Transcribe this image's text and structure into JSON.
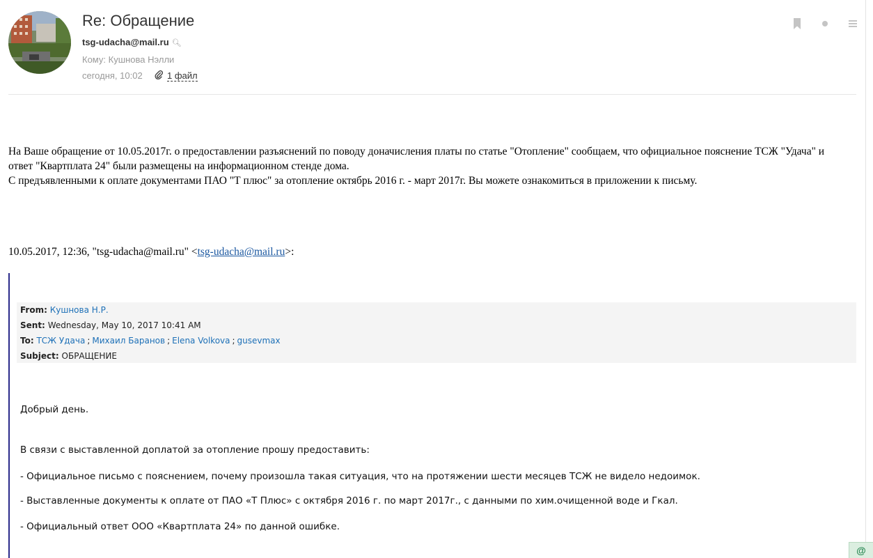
{
  "message": {
    "subject": "Re: Обращение",
    "from": "tsg-udacha@mail.ru",
    "to_label": "Кому:",
    "to": "Кушнова Нэлли",
    "date": "сегодня, 10:02",
    "attachments_label": "1 файл"
  },
  "toolbar": {
    "flag_icon": "bookmark-icon",
    "unread_icon": "dot-icon",
    "more_icon": "menu-icon"
  },
  "body": {
    "line1": "На Ваше обращение от 10.05.2017г. о предоставлении разъяснений по поводу доначисления платы по статье \"Отопление\" сообщаем, что официальное пояснение ТСЖ \"Удача\" и",
    "line2": "ответ \"Квартплата 24\" были размещены на информационном стенде дома.",
    "line3": "С предъявленными к оплате документами ПАО \"Т плюс\" за отопление октябрь 2016 г. - март 2017г. Вы можете ознакомиться в приложении к письму."
  },
  "quote_header": {
    "prefix": "10.05.2017, 12:36, \"tsg-udacha@mail.ru\" <",
    "link": "tsg-udacha@mail.ru",
    "suffix": ">:"
  },
  "original": {
    "from_label": "From:",
    "from": "Кушнова Н.Р.",
    "sent_label": "Sent:",
    "sent": "Wednesday, May 10, 2017 10:41 AM",
    "to_label": "To:",
    "recipients": [
      "ТСЖ Удача",
      "Михаил Баранов",
      "Elena Volkova",
      "gusevmax"
    ],
    "separator": ";",
    "subject_label": "Subject:",
    "subject": "ОБРАЩЕНИЕ",
    "greeting": "Добрый день.",
    "intro": "В связи с выставленной доплатой за отопление прошу предоставить:",
    "items": [
      "- Официальное письмо с пояснением, почему произошла такая ситуация, что на протяжении  шести месяцев ТСЖ не видело недоимок.",
      "- Выставленные документы к оплате от ПАО «Т Плюс» с октября 2016 г. по март 2017г., с данными по хим.очищенной воде и Гкал.",
      "- Официальный ответ ООО «Квартплата 24» по данной ошибке."
    ]
  },
  "corner": {
    "symbol": "@"
  }
}
